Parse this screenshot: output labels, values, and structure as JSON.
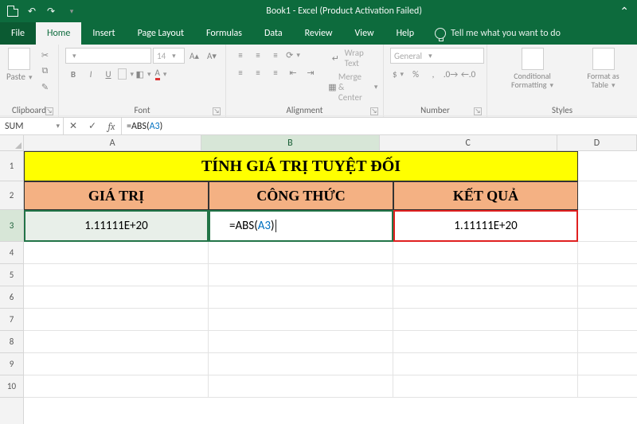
{
  "titlebar": {
    "title": "Book1  -  Excel (Product Activation Failed)"
  },
  "tabs": {
    "file": "File",
    "home": "Home",
    "insert": "Insert",
    "page_layout": "Page Layout",
    "formulas": "Formulas",
    "data": "Data",
    "review": "Review",
    "view": "View",
    "help": "Help",
    "tell_me": "Tell me what you want to do"
  },
  "ribbon": {
    "clipboard": {
      "label": "Clipboard",
      "paste": "Paste"
    },
    "font": {
      "label": "Font",
      "name": "",
      "size": "14",
      "b": "B",
      "i": "I",
      "u": "U"
    },
    "alignment": {
      "label": "Alignment",
      "wrap": "Wrap Text",
      "merge": "Merge & Center"
    },
    "number": {
      "label": "Number",
      "format": "General",
      "dollar": "$",
      "percent": "%",
      "comma": ",",
      "inc": "",
      "dec": ""
    },
    "styles": {
      "label": "Styles",
      "cond": "Conditional Formatting",
      "table": "Format as Table"
    }
  },
  "fxbar": {
    "namebox": "SUM",
    "formula_prefix": "=ABS(",
    "formula_ref": "A3",
    "formula_suffix": ")"
  },
  "columns": [
    "A",
    "B",
    "C",
    "D"
  ],
  "rows": [
    "1",
    "2",
    "3",
    "4",
    "5",
    "6",
    "7",
    "8",
    "9",
    "10"
  ],
  "main_title": "TÍNH GIÁ TRỊ TUYỆT ĐỐI",
  "headers": {
    "a": "GIÁ TRỊ",
    "b": "CÔNG THỨC",
    "c": "KẾT QUẢ"
  },
  "values": {
    "a3": "1.11111E+20",
    "b3_prefix": "=ABS(",
    "b3_ref": "A3",
    "b3_suffix": ")",
    "c3": "1.11111E+20"
  }
}
